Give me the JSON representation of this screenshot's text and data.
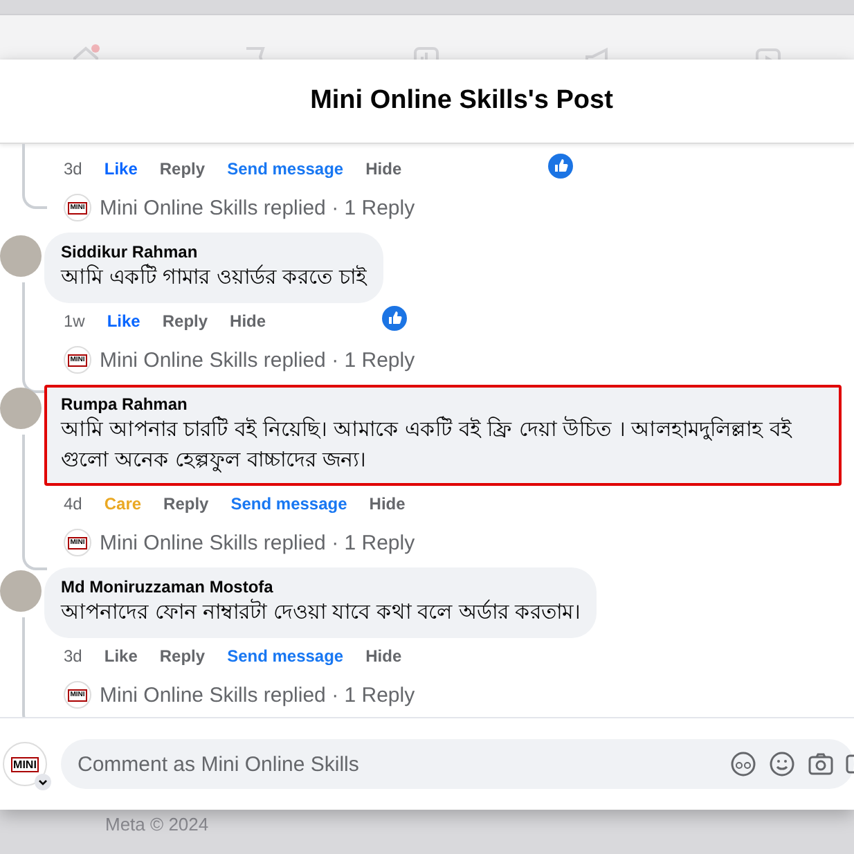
{
  "background": {
    "footer": "Meta © 2024"
  },
  "dialog": {
    "title": "Mini Online Skills's Post"
  },
  "comments": [
    {
      "time": "3d",
      "reaction": {
        "label": "Like",
        "kind": "like"
      },
      "actions": [
        {
          "label": "Reply",
          "kind": "plain"
        },
        {
          "label": "Send message",
          "kind": "message"
        },
        {
          "label": "Hide",
          "kind": "plain"
        }
      ],
      "liked_badge": true,
      "reply_logo": "MINI",
      "replies": "Mini Online Skills replied · 1 Reply"
    },
    {
      "author": "Siddikur Rahman",
      "text": "আমি একটি গামার ওয়ার্ডর করতে চাই",
      "highlighted": false,
      "time": "1w",
      "reaction": {
        "label": "Like",
        "kind": "like"
      },
      "actions": [
        {
          "label": "Reply",
          "kind": "plain"
        },
        {
          "label": "Hide",
          "kind": "plain"
        }
      ],
      "liked_badge": true,
      "reply_logo": "MINI",
      "replies": "Mini Online Skills replied · 1 Reply"
    },
    {
      "author": "Rumpa Rahman",
      "text": "আমি আপনার চারটি বই নিয়েছি। আমাকে একটি বই ফ্রি দেয়া উচিত । আলহামদুলিল্লাহ বই গুলো অনেক হেল্পফুল বাচ্চাদের জন্য।",
      "highlighted": true,
      "time": "4d",
      "reaction": {
        "label": "Care",
        "kind": "care"
      },
      "actions": [
        {
          "label": "Reply",
          "kind": "plain"
        },
        {
          "label": "Send message",
          "kind": "message"
        },
        {
          "label": "Hide",
          "kind": "plain"
        }
      ],
      "liked_badge": false,
      "reply_logo": "MINI",
      "replies": "Mini Online Skills replied · 1 Reply"
    },
    {
      "author": "Md Moniruzzaman Mostofa",
      "text": "আপনাদের ফোন নাম্বারটা দেওয়া যাবে কথা বলে অর্ডার করতাম।",
      "highlighted": false,
      "time": "3d",
      "reaction": {
        "label": "Like",
        "kind": "none"
      },
      "actions": [
        {
          "label": "Reply",
          "kind": "plain"
        },
        {
          "label": "Send message",
          "kind": "message"
        },
        {
          "label": "Hide",
          "kind": "plain"
        }
      ],
      "liked_badge": false,
      "reply_logo": "MINI",
      "replies": "Mini Online Skills replied · 1 Reply"
    }
  ],
  "composer": {
    "logo": "MINI",
    "placeholder": "Comment as Mini Online Skills"
  }
}
